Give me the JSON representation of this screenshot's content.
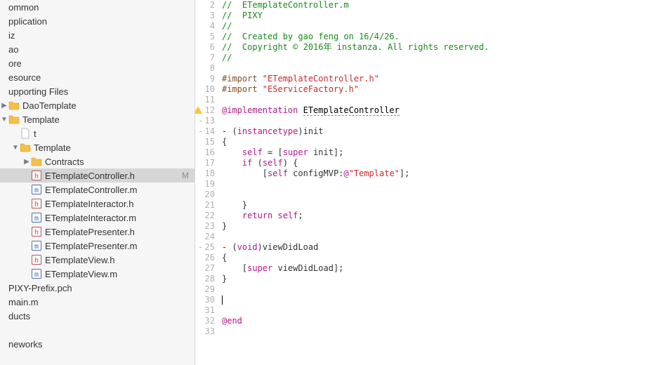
{
  "sidebar": {
    "items": [
      {
        "label": "ommon",
        "depth": 0,
        "icon": null,
        "disc": null
      },
      {
        "label": "pplication",
        "depth": 0,
        "icon": null,
        "disc": null
      },
      {
        "label": "iz",
        "depth": 0,
        "icon": null,
        "disc": null
      },
      {
        "label": "ao",
        "depth": 0,
        "icon": null,
        "disc": null
      },
      {
        "label": "ore",
        "depth": 0,
        "icon": null,
        "disc": null
      },
      {
        "label": "esource",
        "depth": 0,
        "icon": null,
        "disc": null
      },
      {
        "label": "upporting Files",
        "depth": 0,
        "icon": null,
        "disc": null
      },
      {
        "label": "DaoTemplate",
        "depth": 0,
        "icon": "folder",
        "disc": "right"
      },
      {
        "label": "Template",
        "depth": 0,
        "icon": "folder",
        "disc": "down"
      },
      {
        "label": "t",
        "depth": 1,
        "icon": "file-blank",
        "disc": null
      },
      {
        "label": "Template",
        "depth": 1,
        "icon": "folder",
        "disc": "down"
      },
      {
        "label": "Contracts",
        "depth": 2,
        "icon": "folder",
        "disc": "right"
      },
      {
        "label": "ETemplateController.h",
        "depth": 2,
        "icon": "file-h",
        "disc": null,
        "selected": true,
        "status": "M"
      },
      {
        "label": "ETemplateController.m",
        "depth": 2,
        "icon": "file-m",
        "disc": null
      },
      {
        "label": "ETemplateInteractor.h",
        "depth": 2,
        "icon": "file-h",
        "disc": null
      },
      {
        "label": "ETemplateInteractor.m",
        "depth": 2,
        "icon": "file-m",
        "disc": null
      },
      {
        "label": "ETemplatePresenter.h",
        "depth": 2,
        "icon": "file-h",
        "disc": null
      },
      {
        "label": "ETemplatePresenter.m",
        "depth": 2,
        "icon": "file-m",
        "disc": null
      },
      {
        "label": "ETemplateView.h",
        "depth": 2,
        "icon": "file-h",
        "disc": null
      },
      {
        "label": "ETemplateView.m",
        "depth": 2,
        "icon": "file-m",
        "disc": null
      },
      {
        "label": "PIXY-Prefix.pch",
        "depth": 0,
        "icon": null,
        "disc": null
      },
      {
        "label": "main.m",
        "depth": 0,
        "icon": null,
        "disc": null
      },
      {
        "label": "ducts",
        "depth": 0,
        "icon": null,
        "disc": null
      },
      {
        "label": "",
        "depth": 0,
        "icon": null,
        "disc": null
      },
      {
        "label": "neworks",
        "depth": 0,
        "icon": null,
        "disc": null
      }
    ]
  },
  "editor": {
    "lines": [
      {
        "n": 2,
        "kind": "comment",
        "text": "//  ETemplateController.m"
      },
      {
        "n": 3,
        "kind": "comment",
        "text": "//  PIXY"
      },
      {
        "n": 4,
        "kind": "comment",
        "text": "//"
      },
      {
        "n": 5,
        "kind": "comment",
        "text": "//  Created by gao feng on 16/4/26."
      },
      {
        "n": 6,
        "kind": "comment",
        "text": "//  Copyright © 2016年 instanza. All rights reserved."
      },
      {
        "n": 7,
        "kind": "comment",
        "text": "//"
      },
      {
        "n": 8,
        "kind": "blank",
        "text": ""
      },
      {
        "n": 9,
        "kind": "import",
        "pp": "#import ",
        "str": "\"ETemplateController.h\""
      },
      {
        "n": 10,
        "kind": "import",
        "pp": "#import ",
        "str": "\"EServiceFactory.h\""
      },
      {
        "n": 11,
        "kind": "blank",
        "text": ""
      },
      {
        "n": 12,
        "kind": "impl",
        "kw": "@implementation",
        "space": " ",
        "type": "ETemplateController",
        "warn": true
      },
      {
        "n": 13,
        "kind": "blank",
        "text": "",
        "dash": true
      },
      {
        "n": 14,
        "kind": "method",
        "dash": "- (",
        "kw": "instancetype",
        "rest": ")init",
        "dashMark": true
      },
      {
        "n": 15,
        "kind": "plain",
        "text": "{"
      },
      {
        "n": 16,
        "kind": "selfline",
        "pre": "    ",
        "kw1": "self",
        "mid": " = [",
        "kw2": "super",
        "post": " init];"
      },
      {
        "n": 17,
        "kind": "ifline",
        "pre": "    ",
        "kw1": "if",
        "mid": " (",
        "kw2": "self",
        "post": ") {"
      },
      {
        "n": 18,
        "kind": "cfgline",
        "pre": "        [",
        "kw": "self",
        "mid": " configMVP:",
        "at": "@",
        "str": "\"Template\"",
        "post": "];"
      },
      {
        "n": 19,
        "kind": "blank",
        "text": ""
      },
      {
        "n": 20,
        "kind": "blank",
        "text": ""
      },
      {
        "n": 21,
        "kind": "plain",
        "text": "    }"
      },
      {
        "n": 22,
        "kind": "retline",
        "pre": "    ",
        "kw1": "return",
        "mid": " ",
        "kw2": "self",
        "post": ";"
      },
      {
        "n": 23,
        "kind": "plain",
        "text": "}"
      },
      {
        "n": 24,
        "kind": "blank",
        "text": ""
      },
      {
        "n": 25,
        "kind": "method2",
        "dash": "- (",
        "kw": "void",
        "rest": ")viewDidLoad",
        "dashMark": true
      },
      {
        "n": 26,
        "kind": "plain",
        "text": "{"
      },
      {
        "n": 27,
        "kind": "super",
        "pre": "    [",
        "kw": "super",
        "post": " viewDidLoad];"
      },
      {
        "n": 28,
        "kind": "plain",
        "text": "}"
      },
      {
        "n": 29,
        "kind": "blank",
        "text": ""
      },
      {
        "n": 30,
        "kind": "caret",
        "text": ""
      },
      {
        "n": 31,
        "kind": "blank",
        "text": ""
      },
      {
        "n": 32,
        "kind": "end",
        "kw": "@end"
      },
      {
        "n": 33,
        "kind": "blank",
        "text": ""
      }
    ]
  },
  "glyphs": {
    "right": "▶",
    "down": "▼"
  },
  "icons": {
    "folder_fill": "#f5c04a",
    "h_fill": "#fff",
    "h_border": "#c0504d",
    "h_letter": "h",
    "m_fill": "#fff",
    "m_border": "#4a6fa5",
    "m_letter": "m"
  }
}
